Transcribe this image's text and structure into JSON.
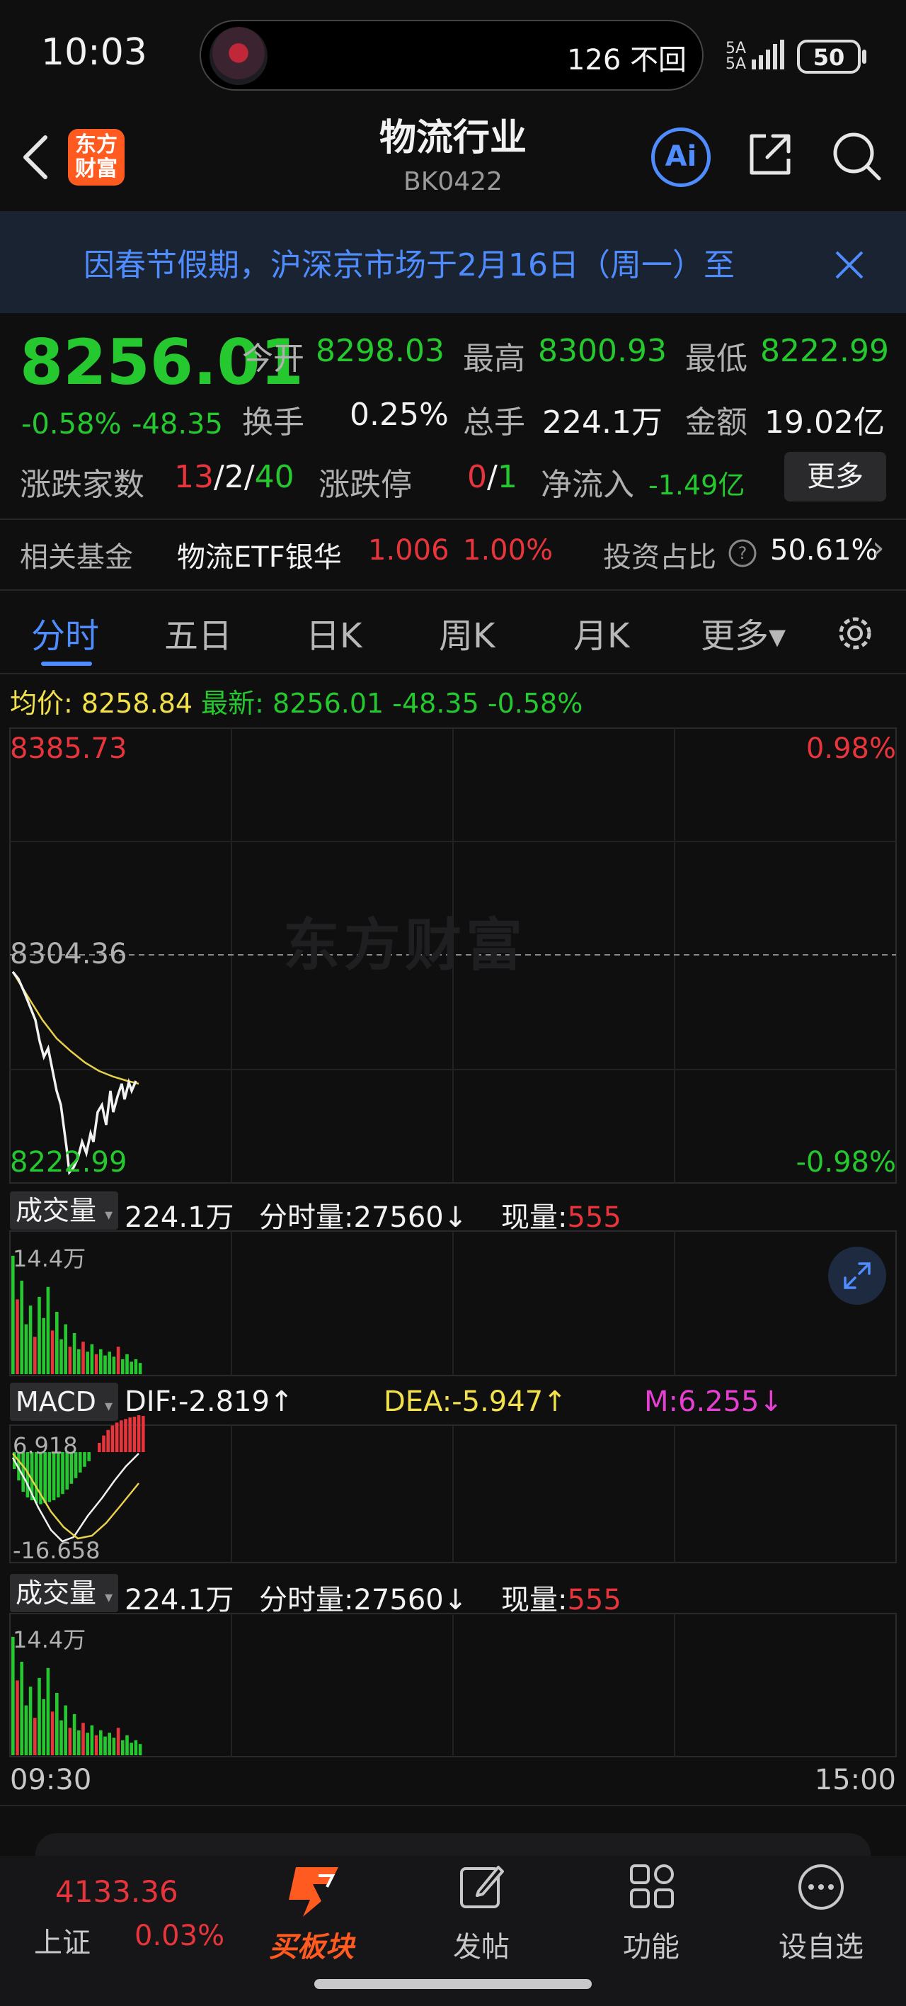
{
  "status": {
    "time": "10:03",
    "pill_text": "126 不回",
    "signal": "5A\n5A",
    "battery": "50"
  },
  "header": {
    "title": "物流行业",
    "code": "BK0422",
    "logo_text": "东方\n财富",
    "ai_label": "Ai"
  },
  "banner": {
    "text": "因春节假期，沪深京市场于2月16日（周一）至"
  },
  "quote": {
    "price": "8256.01",
    "change_pct": "-0.58%",
    "change_abs": "-48.35",
    "open_label": "今开",
    "open": "8298.03",
    "high_label": "最高",
    "high": "8300.93",
    "low_label": "最低",
    "low": "8222.99",
    "turnover_label": "换手",
    "turnover": "0.25%",
    "volume_label": "总手",
    "volume": "224.1万",
    "amount_label": "金额",
    "amount": "19.02亿",
    "breadth_label": "涨跌家数",
    "breadth_up": "13",
    "breadth_flat": "2",
    "breadth_down": "40",
    "limit_label": "涨跌停",
    "limit_up": "0",
    "limit_down": "1",
    "netflow_label": "净流入",
    "netflow": "-1.49亿",
    "more_button": "更多"
  },
  "fund": {
    "label": "相关基金",
    "name": "物流ETF银华",
    "price": "1.006",
    "pct": "1.00%",
    "ratio_label": "投资占比",
    "ratio": "50.61%",
    "chevron": "›"
  },
  "tabs": [
    {
      "label": "分时",
      "active": true
    },
    {
      "label": "五日"
    },
    {
      "label": "日K"
    },
    {
      "label": "周K"
    },
    {
      "label": "月K"
    },
    {
      "label": "更多▾"
    }
  ],
  "infoline": {
    "avg_label": "均价:",
    "avg": "8258.84",
    "latest_label": "最新:",
    "latest": "8256.01",
    "chg": "-48.35",
    "pct": "-0.58%"
  },
  "chart": {
    "y_top": "8385.73",
    "y_mid": "8304.36",
    "y_bottom": "8222.99",
    "pct_top": "0.98%",
    "pct_bottom": "-0.98%",
    "watermark": "东方财富",
    "time_start": "09:30",
    "time_end": "15:00"
  },
  "volume1": {
    "select": "成交量",
    "total": "224.1万",
    "tick_label": "分时量:27560↓",
    "now_label": "现量:",
    "now": "555",
    "max": "14.4万"
  },
  "macd": {
    "select": "MACD",
    "dif": "DIF:-2.819↑",
    "dea": "DEA:-5.947↑",
    "m": "M:6.255↓",
    "top": "6.918",
    "bottom": "-16.658"
  },
  "volume2": {
    "select": "成交量",
    "total": "224.1万",
    "tick_label": "分时量:27560↓",
    "now_label": "现量:",
    "now": "555",
    "max": "14.4万"
  },
  "bottom_nav": {
    "index_value": "4133.36",
    "index_name": "上证",
    "index_pct": "0.03%",
    "items": [
      {
        "label": "买板块"
      },
      {
        "label": "发帖"
      },
      {
        "label": "功能"
      },
      {
        "label": "设自选"
      }
    ]
  }
}
